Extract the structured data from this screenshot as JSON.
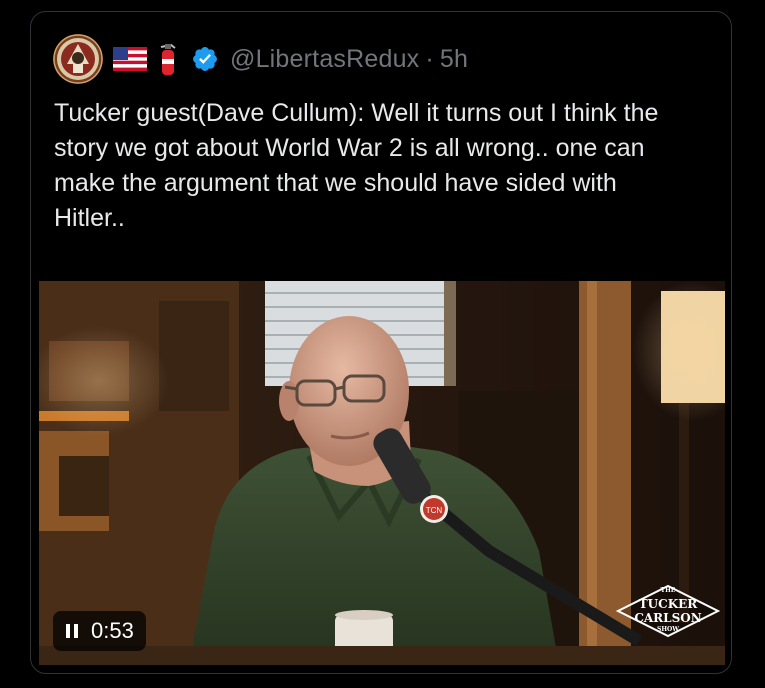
{
  "tweet": {
    "handle": "@LibertasRedux",
    "separator": "·",
    "timestamp": "5h",
    "text": "Tucker guest(Dave Cullum): Well it turns out I think the story we got about World War 2 is all wrong.. one can make the argument that we should have sided with Hitler..",
    "header_icons": [
      "avatar",
      "us-flag-icon",
      "fire-extinguisher-icon",
      "verified-badge-icon"
    ],
    "accent_color": "#1d9bf0"
  },
  "video": {
    "state_icon": "pause-icon",
    "elapsed": "0:53",
    "watermark": {
      "line1": "THE",
      "line2": "TUCKER",
      "line3": "CARLSON",
      "line4": "SHOW"
    },
    "mic_badge": "TCN"
  }
}
